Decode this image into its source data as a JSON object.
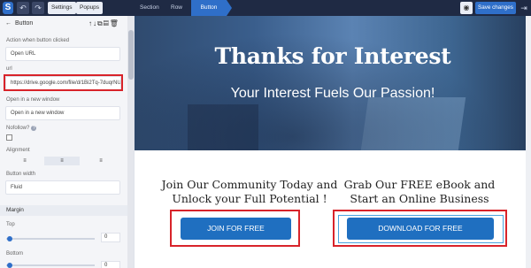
{
  "topbar": {
    "logo": "S",
    "undo_icon": "↶",
    "redo_icon": "↷",
    "settings_label": "Settings",
    "popups_label": "Popups",
    "breadcrumbs": [
      "Section",
      "Row",
      "Button"
    ],
    "eye_icon": "◉",
    "save_label": "Save changes",
    "exit_icon": "⇥"
  },
  "sidebar": {
    "back_icon": "←",
    "title": "Button",
    "tools": "↑↓⧉▤🗑",
    "action_label": "Action when button clicked",
    "action_value": "Open URL",
    "url_label": "url",
    "url_value": "https://drive.google.com/file/d/1Bi2Tq-7duqrNU7",
    "open_in_label": "Open in a new window",
    "open_in_value": "Open in a new window",
    "nofollow_label": "Nofollow?",
    "help_icon": "?",
    "alignment_label": "Alignment",
    "align_options": [
      "≡",
      "≡",
      "≡"
    ],
    "width_label": "Button width",
    "width_value": "Fluid",
    "margin_section": "Margin",
    "top_label": "Top",
    "top_value": "0",
    "bottom_label": "Bottom",
    "bottom_value": "0"
  },
  "canvas": {
    "hero_title": "Thanks for Interest",
    "hero_subtitle": "Your Interest Fuels Our Passion!",
    "left_heading": "Join Our Community Today and Unlock your Full Potential !",
    "left_button": "JOIN FOR FREE",
    "right_heading": "Grab Our FREE eBook and Start an Online Business",
    "right_button": "DOWNLOAD FOR FREE"
  },
  "colors": {
    "topbar": "#1f2a44",
    "accent": "#2f6fc9",
    "cta": "#1f6fc0",
    "highlight": "#d8232a"
  }
}
